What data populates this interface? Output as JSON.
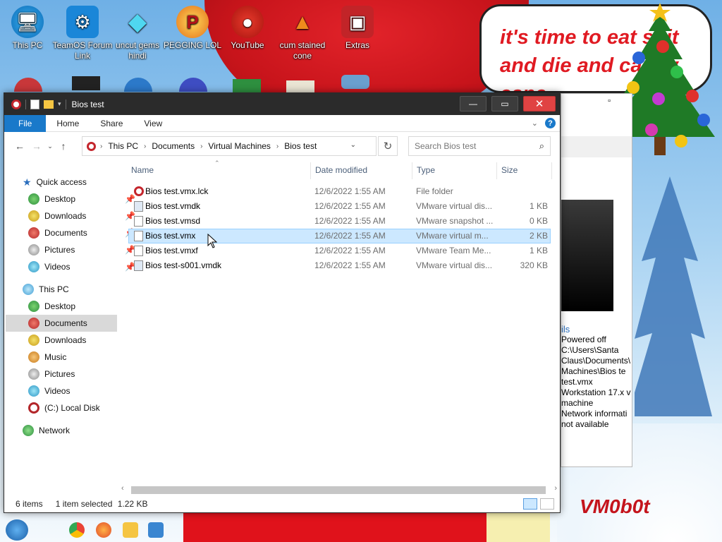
{
  "desktop": {
    "icons": [
      {
        "label": "This PC",
        "icon": "monitor-icon"
      },
      {
        "label": "TeamOS Forum Link",
        "icon": "gear-icon"
      },
      {
        "label": "uncut gems hindi",
        "icon": "diamond-icon"
      },
      {
        "label": "PEGGING LOL",
        "icon": "letter-p-icon"
      },
      {
        "label": "YouTube",
        "icon": "angry-bird-icon"
      },
      {
        "label": "cum stained cone",
        "icon": "traffic-cone-icon"
      },
      {
        "label": "Extras",
        "icon": "gift-icon"
      }
    ],
    "speech_text": "it's time to eat shit and die and candy cane",
    "watermark": "VM0b0t"
  },
  "background_window": {
    "details_heading": "ils",
    "details_lines": [
      "Powered off",
      "C:\\Users\\Santa",
      "Claus\\Documents\\",
      "Machines\\Bios te",
      "test.vmx",
      "Workstation 17.x v",
      "machine",
      "Network informati",
      "not available"
    ]
  },
  "explorer": {
    "title": "Bios test",
    "ribbon_tabs": [
      "File",
      "Home",
      "Share",
      "View"
    ],
    "breadcrumb": [
      "This PC",
      "Documents",
      "Virtual Machines",
      "Bios test"
    ],
    "search_placeholder": "Search Bios test",
    "nav": {
      "quick_access": "Quick access",
      "quick_items": [
        "Desktop",
        "Downloads",
        "Documents",
        "Pictures",
        "Videos"
      ],
      "this_pc": "This PC",
      "pc_items": [
        "Desktop",
        "Documents",
        "Downloads",
        "Music",
        "Pictures",
        "Videos",
        "(C:) Local Disk"
      ],
      "network": "Network",
      "selected": "Documents"
    },
    "columns": {
      "name": "Name",
      "date": "Date modified",
      "type": "Type",
      "size": "Size"
    },
    "files": [
      {
        "name": "Bios test.vmx.lck",
        "date": "12/6/2022 1:55 AM",
        "type": "File folder",
        "size": ""
      },
      {
        "name": "Bios test.vmdk",
        "date": "12/6/2022 1:55 AM",
        "type": "VMware virtual dis...",
        "size": "1 KB"
      },
      {
        "name": "Bios test.vmsd",
        "date": "12/6/2022 1:55 AM",
        "type": "VMware snapshot ...",
        "size": "0 KB"
      },
      {
        "name": "Bios test.vmx",
        "date": "12/6/2022 1:55 AM",
        "type": "VMware virtual m...",
        "size": "2 KB"
      },
      {
        "name": "Bios test.vmxf",
        "date": "12/6/2022 1:55 AM",
        "type": "VMware Team Me...",
        "size": "1 KB"
      },
      {
        "name": "Bios test-s001.vmdk",
        "date": "12/6/2022 1:55 AM",
        "type": "VMware virtual dis...",
        "size": "320 KB"
      }
    ],
    "selected_file": "Bios test.vmx",
    "status": {
      "count": "6 items",
      "selection": "1 item selected",
      "size": "1.22 KB"
    }
  },
  "colors": {
    "accent": "#1979ca",
    "selection": "#cce8ff",
    "titlebar": "#2b2b2b",
    "close": "#e04343"
  }
}
